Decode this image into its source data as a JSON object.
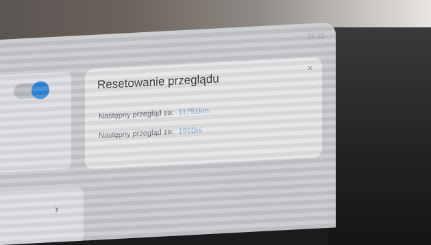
{
  "status": {
    "time": "12:22"
  },
  "toggle": {
    "state": "on",
    "accent": "#2f87d8"
  },
  "nav": {
    "chevron_icon": "chevron-right-icon"
  },
  "card": {
    "title": "Resetowanie przeglądu",
    "rows": [
      {
        "label": "Następny przegląd za:",
        "value": "11751km"
      },
      {
        "label": "Następny przegląd za:",
        "value": "191Dni"
      }
    ]
  }
}
